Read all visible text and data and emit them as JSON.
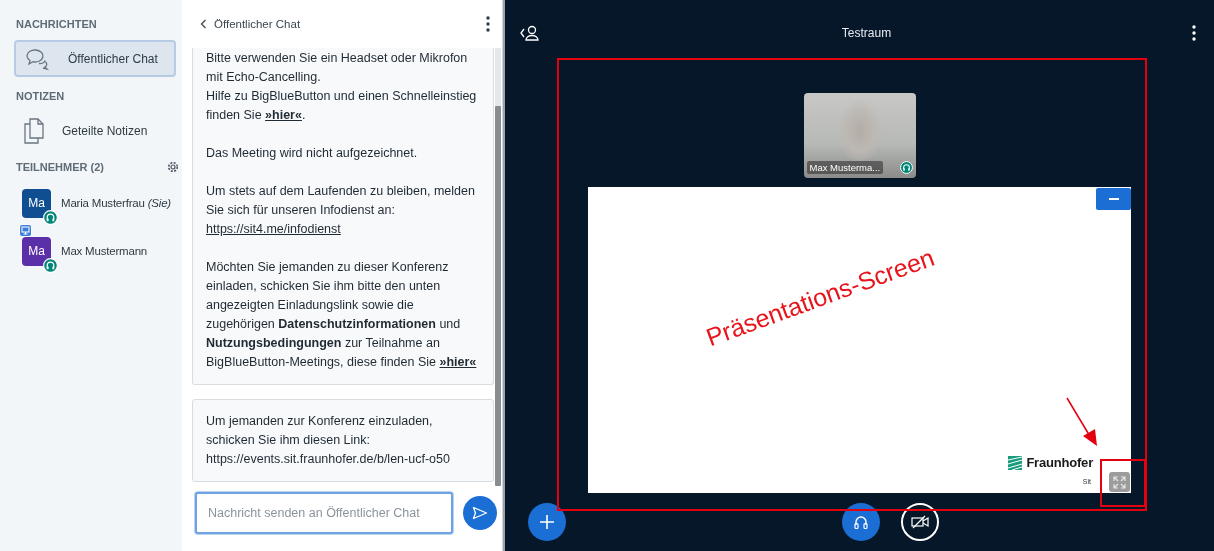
{
  "sidebar": {
    "sections": [
      {
        "title": "NACHRICHTEN",
        "items": [
          {
            "kind": "chat",
            "label": "Öffentlicher Chat",
            "selected": true
          }
        ]
      },
      {
        "title": "NOTIZEN",
        "items": [
          {
            "kind": "notes",
            "label": "Geteilte Notizen",
            "selected": false
          }
        ]
      }
    ],
    "participants": {
      "title": "TEILNEHMER (2)",
      "users": [
        {
          "initials": "Ma",
          "name": "Maria Musterfrau *(Sie)*",
          "color": "#0f4f91",
          "presenter": false
        },
        {
          "initials": "Ma",
          "name": "Max Mustermann",
          "color": "#5b2fa8",
          "presenter": true
        }
      ]
    }
  },
  "chat": {
    "title": "Öffentlicher Chat",
    "messages": [
      {
        "paragraphs": [
          [
            [
              {
                "kind": "text",
                "text": "Bitte verwenden Sie ein Headset oder Mikrofon mit Echo-Cancelling."
              }
            ],
            [
              {
                "kind": "text",
                "text": "Hilfe zu BigBlueButton und einen Schnelleinstieg finden Sie "
              },
              {
                "kind": "link",
                "text": "**»hier«**"
              },
              {
                "kind": "text",
                "text": "."
              }
            ]
          ],
          [
            [
              {
                "kind": "text",
                "text": "Das Meeting wird nicht aufgezeichnet."
              }
            ]
          ],
          [
            [
              {
                "kind": "text",
                "text": "Um stets auf dem Laufenden zu bleiben, melden Sie sich für unseren Infodienst an:"
              }
            ],
            [
              {
                "kind": "link",
                "text": "https://sit4.me/infodienst"
              }
            ]
          ],
          [
            [
              {
                "kind": "text",
                "text": "Möchten Sie jemanden zu dieser Konferenz einladen, schicken Sie ihm bitte den unten angezeigten Einladungslink sowie die zugehörigen **Datenschutzinformationen** und **Nutzungsbedingungen** zur Teilnahme an BigBlueButton-Meetings, diese finden Sie "
              },
              {
                "kind": "link",
                "text": "**»hier«**"
              }
            ]
          ]
        ]
      },
      {
        "paragraphs": [
          [
            [
              {
                "kind": "text",
                "text": "Um jemanden zur Konferenz einzuladen, schicken Sie ihm diesen Link: https://events.sit.fraunhofer.de/b/len-ucf-o50"
              }
            ]
          ]
        ]
      }
    ],
    "input": {
      "placeholder": "Nachricht senden an Öffentlicher Chat",
      "focused": true
    }
  },
  "main": {
    "title": "Testraum",
    "webcam": {
      "name": "Max Musterma..."
    },
    "slide": {
      "logo": "Fraunhofer",
      "logo_subtitle": "Sit"
    },
    "annotation": {
      "label": "Präsentations-Screen"
    }
  }
}
